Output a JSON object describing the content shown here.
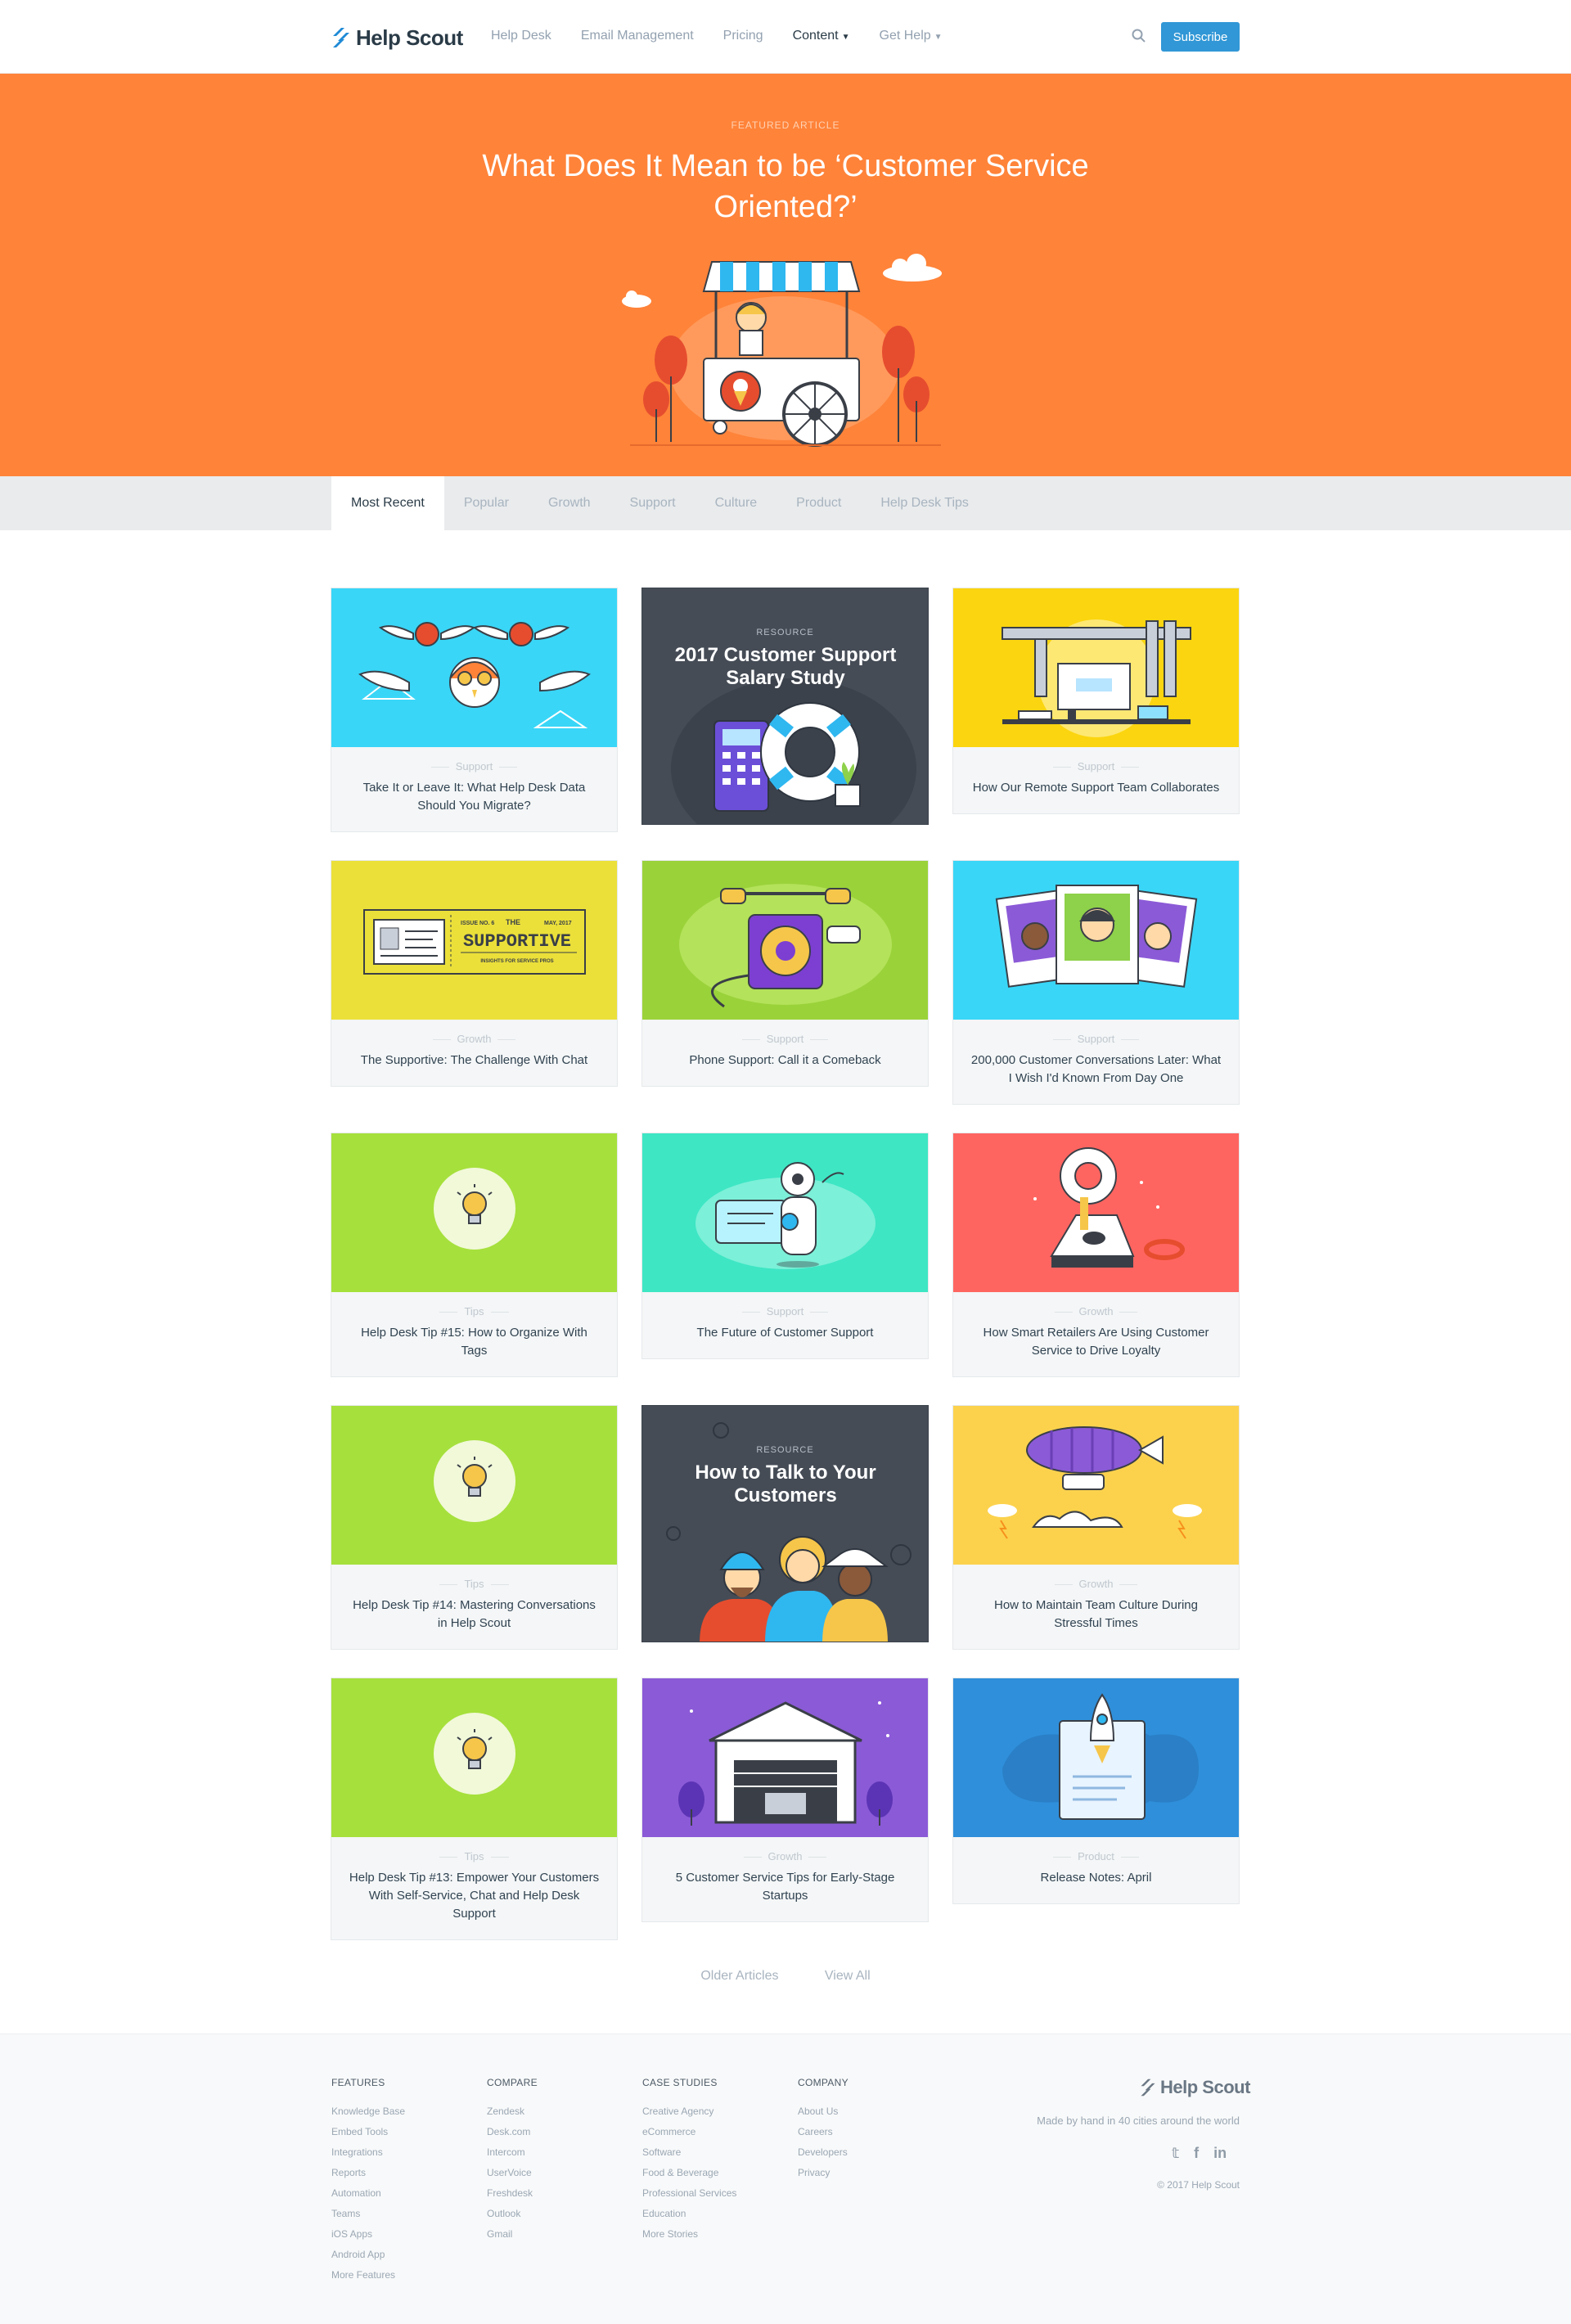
{
  "header": {
    "logo_text": "Help Scout",
    "nav": [
      {
        "label": "Help Desk"
      },
      {
        "label": "Email Management"
      },
      {
        "label": "Pricing"
      },
      {
        "label": "Content"
      },
      {
        "label": "Get Help"
      }
    ],
    "subscribe_label": "Subscribe"
  },
  "hero": {
    "kicker": "FEATURED ARTICLE",
    "title": "What Does It Mean to be ‘Customer Service Oriented?’",
    "background": "#ff8339"
  },
  "tabs": [
    {
      "label": "Most Recent"
    },
    {
      "label": "Popular"
    },
    {
      "label": "Growth"
    },
    {
      "label": "Support"
    },
    {
      "label": "Culture"
    },
    {
      "label": "Product"
    },
    {
      "label": "Help Desk Tips"
    }
  ],
  "cards": [
    {
      "category": "Support",
      "title": "Take It or Leave It: What Help Desk Data Should You Migrate?",
      "thumb_color": "#39d6f7"
    },
    {
      "kicker": "RESOURCE",
      "title": "2017 Customer Support Salary Study"
    },
    {
      "category": "Support",
      "title": "How Our Remote Support Team Collaborates",
      "thumb_color": "#fbd50f"
    },
    {
      "category": "Growth",
      "title": "The Supportive: The Challenge With Chat",
      "thumb_color": "#ebe03a",
      "art": {
        "issue": "ISSUE NO. 6",
        "date": "MAY, 2017",
        "the": "THE",
        "name": "SUPPORTIVE",
        "sub": "INSIGHTS FOR SERVICE PROS"
      }
    },
    {
      "category": "Support",
      "title": "Phone Support: Call it a Comeback",
      "thumb_color": "#9ad23a"
    },
    {
      "category": "Support",
      "title": "200,000 Customer Conversations Later: What I Wish I'd Known From Day One",
      "thumb_color": "#39d6f7"
    },
    {
      "category": "Tips",
      "title": "Help Desk Tip #15: How to Organize With Tags",
      "thumb_color": "#a6e03c"
    },
    {
      "category": "Support",
      "title": "The Future of Customer Support",
      "thumb_color": "#3ee6c4"
    },
    {
      "category": "Growth",
      "title": "How Smart Retailers Are Using Customer Service to Drive Loyalty",
      "thumb_color": "#ff6560"
    },
    {
      "category": "Tips",
      "title": "Help Desk Tip #14: Mastering Conversations in Help Scout",
      "thumb_color": "#a6e03c"
    },
    {
      "kicker": "RESOURCE",
      "title": "How to Talk to Your Customers"
    },
    {
      "category": "Growth",
      "title": "How to Maintain Team Culture During Stressful Times",
      "thumb_color": "#fcd24d"
    },
    {
      "category": "Tips",
      "title": "Help Desk Tip #13: Empower Your Customers With Self-Service, Chat and Help Desk Support",
      "thumb_color": "#a6e03c"
    },
    {
      "category": "Growth",
      "title": "5 Customer Service Tips for Early-Stage Startups",
      "thumb_color": "#8b5ad7"
    },
    {
      "category": "Product",
      "title": "Release Notes: April",
      "thumb_color": "#2f8fdb"
    }
  ],
  "pager": {
    "older": "Older Articles",
    "view_all": "View All"
  },
  "footer": {
    "columns": [
      {
        "heading": "FEATURES",
        "links": [
          "Knowledge Base",
          "Embed Tools",
          "Integrations",
          "Reports",
          "Automation",
          "Teams",
          "iOS Apps",
          "Android App",
          "More Features"
        ]
      },
      {
        "heading": "COMPARE",
        "links": [
          "Zendesk",
          "Desk.com",
          "Intercom",
          "UserVoice",
          "Freshdesk",
          "Outlook",
          "Gmail"
        ]
      },
      {
        "heading": "CASE STUDIES",
        "links": [
          "Creative Agency",
          "eCommerce",
          "Software",
          "Food & Beverage",
          "Professional Services",
          "Education",
          "More Stories"
        ]
      },
      {
        "heading": "COMPANY",
        "links": [
          "About Us",
          "Careers",
          "Developers",
          "Privacy"
        ]
      }
    ],
    "logo_text": "Help Scout",
    "tagline": "Made by hand in 40 cities around the world",
    "social": {
      "twitter": "𝕥",
      "facebook": "f",
      "linkedin": "in"
    },
    "copyright": "© 2017 Help Scout"
  }
}
